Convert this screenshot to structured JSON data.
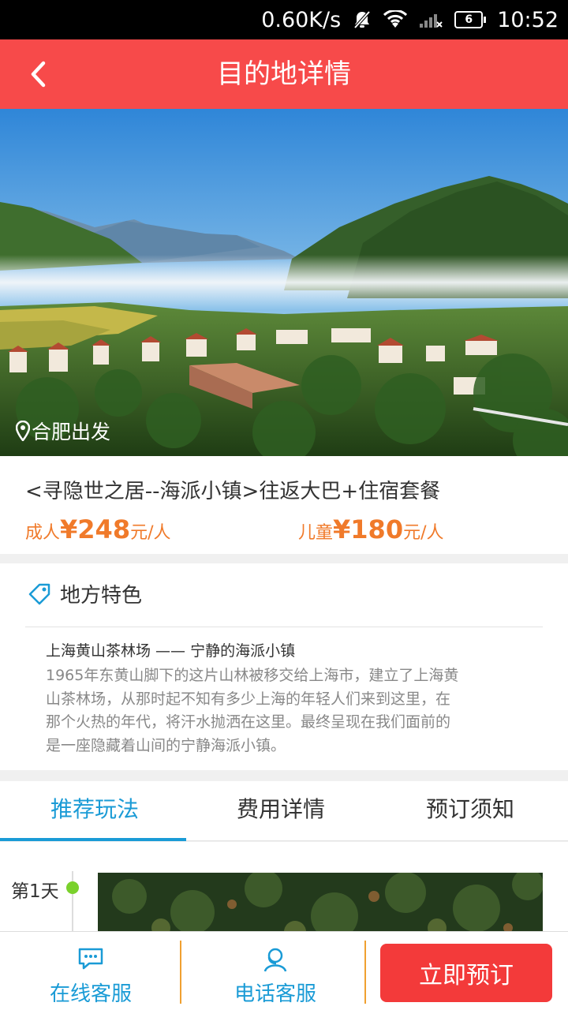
{
  "status_bar": {
    "net_speed": "0.60K/s",
    "battery": "6",
    "time": "10:52",
    "icons": [
      "notification-muted-icon",
      "wifi-icon",
      "signal-icon"
    ]
  },
  "nav": {
    "title": "目的地详情",
    "back_icon": "chevron-left-icon"
  },
  "hero": {
    "departure": "合肥出发",
    "slide_count": 6,
    "active_slide": 1
  },
  "product": {
    "title": "<寻隐世之居--海派小镇>往返大巴+住宿套餐",
    "adult": {
      "label": "成人",
      "price": "¥248",
      "unit": "元/人"
    },
    "child": {
      "label": "儿童",
      "price": "¥180",
      "unit": "元/人"
    }
  },
  "feature": {
    "title": "地方特色",
    "subtitle": "上海黄山茶林场 —— 宁静的海派小镇",
    "lines": [
      "1965年东黄山脚下的这片山林被移交给上海市，建立了上海黄",
      "山茶林场，从那时起不知有多少上海的年轻人们来到这里，在",
      "那个火热的年代，将汗水抛洒在这里。最终呈现在我们面前的",
      "是一座隐藏着山间的宁静海派小镇。"
    ]
  },
  "tabs": [
    {
      "label": "推荐玩法",
      "active": true
    },
    {
      "label": "费用详情",
      "active": false
    },
    {
      "label": "预订须知",
      "active": false
    }
  ],
  "itinerary": {
    "day_label": "第1天"
  },
  "bottom_bar": {
    "online_service": "在线客服",
    "phone_service": "电话客服",
    "book_now": "立即预订"
  },
  "colors": {
    "nav": "#f74a4a",
    "accent_blue": "#1a9bd6",
    "price_orange": "#f07a2a",
    "book_button": "#f33a3a",
    "timeline_green": "#7ad12c"
  }
}
